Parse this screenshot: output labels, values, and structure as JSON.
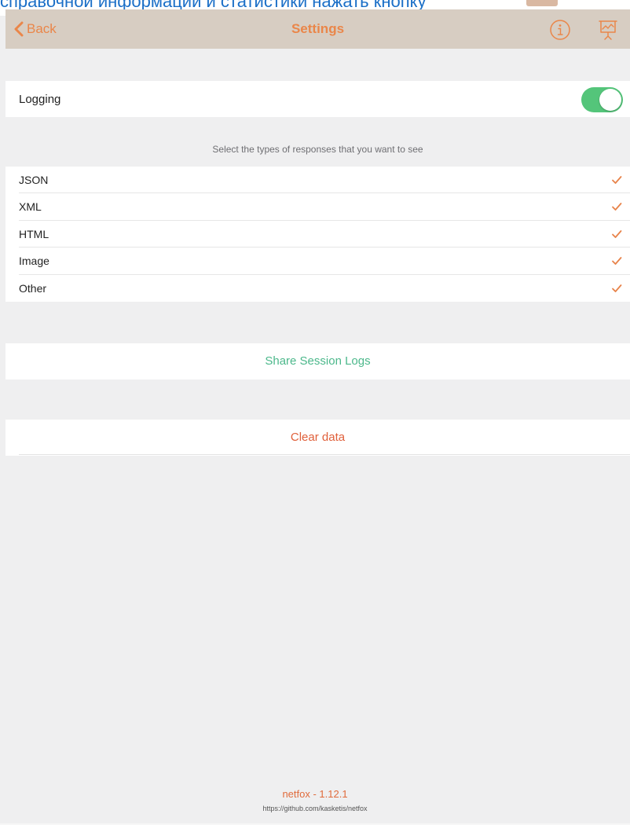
{
  "top_caption": {
    "text": "справочной информации и статистики нажать кнопку"
  },
  "navbar": {
    "back_label": "Back",
    "title": "Settings",
    "accent_color": "#ea8649",
    "info_icon": "info-icon",
    "statistics_icon": "presentation-chart-icon"
  },
  "settings": {
    "logging_label": "Logging",
    "logging_enabled": true,
    "switch_color": "#54c57a"
  },
  "response_types": {
    "header": "Select the types of responses that you want to see",
    "items": [
      {
        "label": "JSON",
        "selected": true
      },
      {
        "label": "XML",
        "selected": true
      },
      {
        "label": "HTML",
        "selected": true
      },
      {
        "label": "Image",
        "selected": true
      },
      {
        "label": "Other",
        "selected": true
      }
    ],
    "check_color": "#e8834a"
  },
  "actions": {
    "share_label": "Share Session Logs",
    "share_color": "#4cb88b",
    "clear_label": "Clear data",
    "clear_color": "#e0603b"
  },
  "footer": {
    "version": "netfox - 1.12.1",
    "url": "https://github.com/kasketis/netfox"
  }
}
